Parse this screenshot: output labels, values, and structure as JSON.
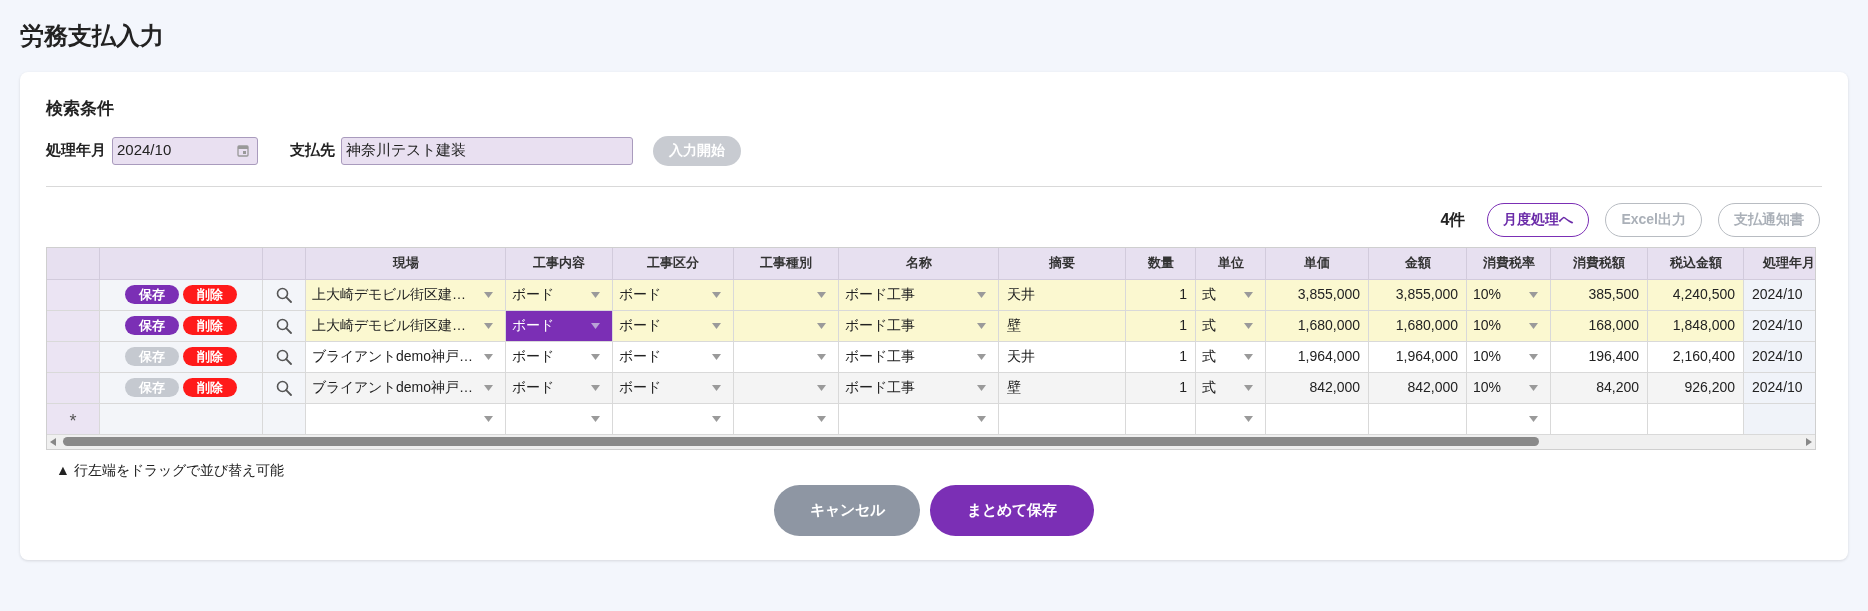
{
  "page_title": "労務支払入力",
  "search": {
    "heading": "検索条件",
    "fields": [
      {
        "label": "処理年月",
        "value": "2024/10",
        "kind": "date"
      },
      {
        "label": "支払先",
        "value": "神奈川テスト建装",
        "kind": "text"
      }
    ],
    "start_button": {
      "label": "入力開始",
      "disabled": true
    }
  },
  "toolbar": {
    "count": "4件",
    "buttons": [
      {
        "label": "月度処理へ",
        "disabled": false
      },
      {
        "label": "Excel出力",
        "disabled": true
      },
      {
        "label": "支払通知書",
        "disabled": true
      }
    ]
  },
  "table": {
    "columns": [
      {
        "label": "現場",
        "kind": "select"
      },
      {
        "label": "工事内容",
        "kind": "select"
      },
      {
        "label": "工事区分",
        "kind": "select"
      },
      {
        "label": "工事種別",
        "kind": "select"
      },
      {
        "label": "名称",
        "kind": "select"
      },
      {
        "label": "摘要",
        "kind": "text"
      },
      {
        "label": "数量",
        "kind": "number"
      },
      {
        "label": "単位",
        "kind": "select"
      },
      {
        "label": "単価",
        "kind": "number"
      },
      {
        "label": "金額",
        "kind": "number"
      },
      {
        "label": "消費税率",
        "kind": "select"
      },
      {
        "label": "消費税額",
        "kind": "number"
      },
      {
        "label": "税込金額",
        "kind": "number"
      },
      {
        "label": "処理年月",
        "kind": "readonly"
      }
    ],
    "rows": [
      {
        "modified": true,
        "save_label": "保存",
        "save_disabled": false,
        "delete_label": "削除",
        "cells": [
          {
            "text": "上大崎デモビル街区建…",
            "selected": false
          },
          {
            "text": "ボード",
            "selected": false
          },
          {
            "text": "ボード",
            "selected": false
          },
          {
            "selected": false
          },
          {
            "text": "ボード工事",
            "selected": false
          },
          {
            "text": "天井",
            "selected": false
          },
          {
            "text": "1",
            "selected": false
          },
          {
            "text": "式",
            "selected": false
          },
          {
            "text": "3,855,000",
            "selected": false
          },
          {
            "text": "3,855,000",
            "selected": false
          },
          {
            "text": "10%",
            "selected": false
          },
          {
            "text": "385,500",
            "selected": false
          },
          {
            "text": "4,240,500",
            "selected": false
          },
          {
            "text": "2024/10",
            "selected": false
          }
        ]
      },
      {
        "modified": true,
        "save_label": "保存",
        "save_disabled": false,
        "delete_label": "削除",
        "cells": [
          {
            "text": "上大崎デモビル街区建…",
            "selected": false
          },
          {
            "text": "ボード",
            "selected": true
          },
          {
            "text": "ボード",
            "selected": false
          },
          {
            "selected": false
          },
          {
            "text": "ボード工事",
            "selected": false
          },
          {
            "text": "壁",
            "selected": false
          },
          {
            "text": "1",
            "selected": false
          },
          {
            "text": "式",
            "selected": false
          },
          {
            "text": "1,680,000",
            "selected": false
          },
          {
            "text": "1,680,000",
            "selected": false
          },
          {
            "text": "10%",
            "selected": false
          },
          {
            "text": "168,000",
            "selected": false
          },
          {
            "text": "1,848,000",
            "selected": false
          },
          {
            "text": "2024/10",
            "selected": false
          }
        ]
      },
      {
        "modified": false,
        "save_label": "保存",
        "save_disabled": true,
        "delete_label": "削除",
        "cells": [
          {
            "text": "ブライアントdemo神戸…",
            "selected": false
          },
          {
            "text": "ボード",
            "selected": false
          },
          {
            "text": "ボード",
            "selected": false
          },
          {
            "selected": false
          },
          {
            "text": "ボード工事",
            "selected": false
          },
          {
            "text": "天井",
            "selected": false
          },
          {
            "text": "1",
            "selected": false
          },
          {
            "text": "式",
            "selected": false
          },
          {
            "text": "1,964,000",
            "selected": false
          },
          {
            "text": "1,964,000",
            "selected": false
          },
          {
            "text": "10%",
            "selected": false
          },
          {
            "text": "196,400",
            "selected": false
          },
          {
            "text": "2,160,400",
            "selected": false
          },
          {
            "text": "2024/10",
            "selected": false
          }
        ]
      },
      {
        "modified": false,
        "save_label": "保存",
        "save_disabled": true,
        "delete_label": "削除",
        "cells": [
          {
            "text": "ブライアントdemo神戸…",
            "selected": false
          },
          {
            "text": "ボード",
            "selected": false
          },
          {
            "text": "ボード",
            "selected": false
          },
          {
            "selected": false
          },
          {
            "text": "ボード工事",
            "selected": false
          },
          {
            "text": "壁",
            "selected": false
          },
          {
            "text": "1",
            "selected": false
          },
          {
            "text": "式",
            "selected": false
          },
          {
            "text": "842,000",
            "selected": false
          },
          {
            "text": "842,000",
            "selected": false
          },
          {
            "text": "10%",
            "selected": false
          },
          {
            "text": "84,200",
            "selected": false
          },
          {
            "text": "926,200",
            "selected": false
          },
          {
            "text": "2024/10",
            "selected": false
          }
        ]
      }
    ],
    "new_row": {
      "marker": "*"
    }
  },
  "note": "▲ 行左端をドラッグで並び替え可能",
  "actions": [
    {
      "label": "キャンセル",
      "kind": "cancel"
    },
    {
      "label": "まとめて保存",
      "kind": "primary"
    }
  ]
}
